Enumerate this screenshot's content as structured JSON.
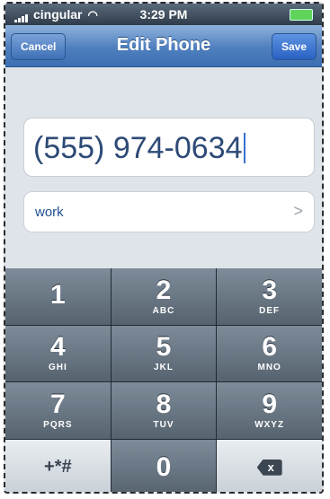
{
  "status_bar": {
    "carrier": "cingular",
    "time": "3:29 PM"
  },
  "nav": {
    "title": "Edit Phone",
    "cancel_label": "Cancel",
    "save_label": "Save"
  },
  "phone": {
    "value": "(555) 974-0634",
    "label": "work",
    "chevron": ">"
  },
  "keypad": {
    "keys": [
      {
        "digit": "1",
        "letters": ""
      },
      {
        "digit": "2",
        "letters": "ABC"
      },
      {
        "digit": "3",
        "letters": "DEF"
      },
      {
        "digit": "4",
        "letters": "GHI"
      },
      {
        "digit": "5",
        "letters": "JKL"
      },
      {
        "digit": "6",
        "letters": "MNO"
      },
      {
        "digit": "7",
        "letters": "PQRS"
      },
      {
        "digit": "8",
        "letters": "TUV"
      },
      {
        "digit": "9",
        "letters": "WXYZ"
      }
    ],
    "special_label": "+*#",
    "zero": "0",
    "backspace_symbol": "x"
  }
}
